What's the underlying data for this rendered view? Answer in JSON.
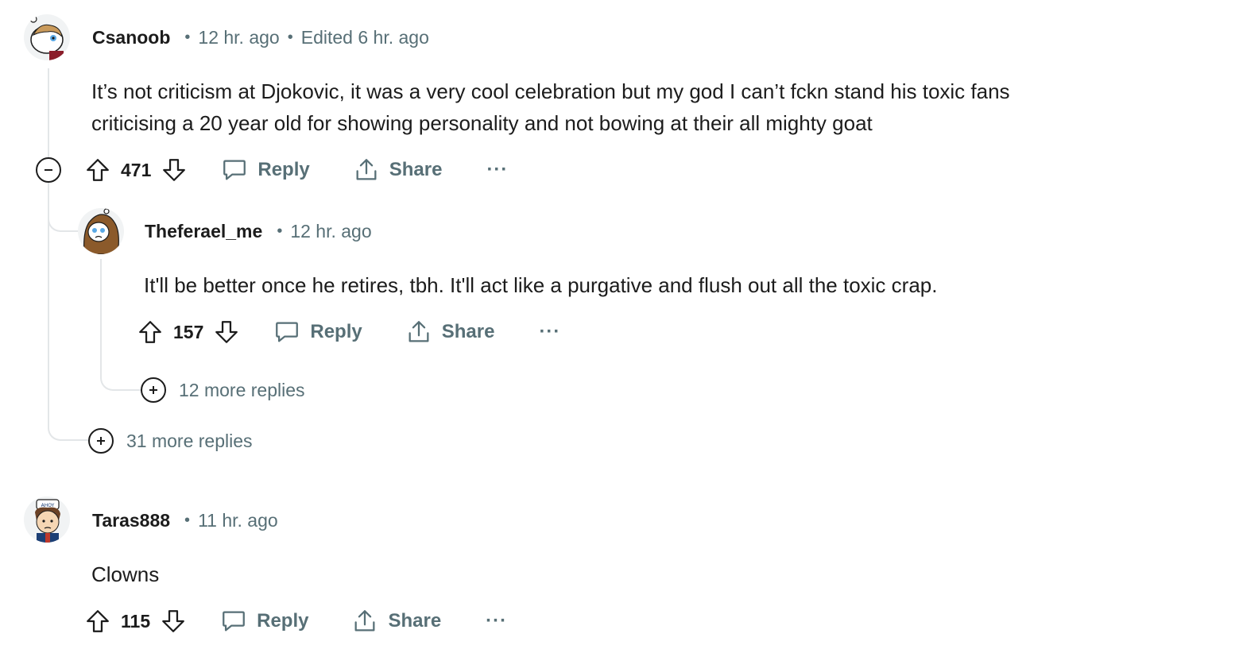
{
  "comments": [
    {
      "username": "Csanoob",
      "time": "12 hr. ago",
      "edited": "Edited 6 hr. ago",
      "body_lines": [
        "It’s not criticism at Djokovic, it was a very cool celebration but my god I can’t fckn stand his toxic fans",
        "criticising a 20 year old for showing personality and not bowing at their all mighty goat"
      ],
      "score": "471",
      "reply_label": "Reply",
      "share_label": "Share",
      "more_label": "···",
      "more_replies": "31 more replies"
    },
    {
      "username": "Theferael_me",
      "time": "12 hr. ago",
      "body": "It'll be better once he retires, tbh. It'll act like a purgative and flush out all the toxic crap.",
      "score": "157",
      "reply_label": "Reply",
      "share_label": "Share",
      "more_label": "···",
      "more_replies": "12 more replies"
    },
    {
      "username": "Taras888",
      "time": "11 hr. ago",
      "body": "Clowns",
      "score": "115",
      "reply_label": "Reply",
      "share_label": "Share",
      "more_label": "···"
    }
  ],
  "icons": {
    "upvote": "upvote-icon",
    "downvote": "downvote-icon",
    "reply": "comment-bubble-icon",
    "share": "share-icon",
    "collapse": "minus-circle-icon",
    "expand": "plus-circle-icon"
  },
  "colors": {
    "text": "#1c1c1c",
    "meta": "#576f76",
    "thread_line": "#e3e6e8"
  }
}
